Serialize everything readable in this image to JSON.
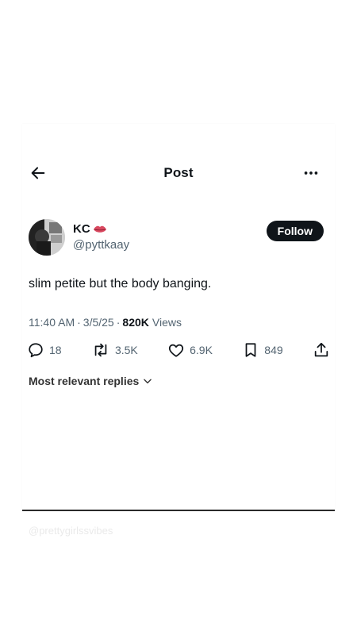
{
  "header": {
    "title": "Post"
  },
  "author": {
    "display_name": "KC",
    "handle": "@pyttkaay",
    "follow_label": "Follow"
  },
  "post": {
    "text": "slim petite but the body banging.",
    "time": "11:40 AM",
    "date": "3/5/25",
    "views_count": "820K",
    "views_label": "Views"
  },
  "actions": {
    "replies": "18",
    "reposts": "3.5K",
    "likes": "6.9K",
    "bookmarks": "849"
  },
  "replies_filter": {
    "label": "Most relevant replies"
  },
  "watermark": "@prettygirlssvibes",
  "colors": {
    "text": "#0f1419",
    "muted": "#536471",
    "button": "#0f1419",
    "emoji_lips": "#d9485f"
  },
  "icons": [
    "back-arrow-icon",
    "more-dots-icon",
    "lips-emoji-icon",
    "reply-icon",
    "repost-icon",
    "like-icon",
    "bookmark-icon",
    "share-icon",
    "chevron-down-icon"
  ]
}
